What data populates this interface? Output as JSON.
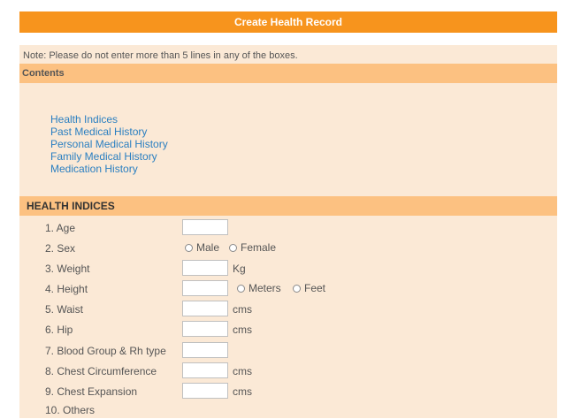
{
  "header": {
    "title": "Create Health Record"
  },
  "note": "Note: Please do not enter more than 5 lines in any of the boxes.",
  "contents": {
    "title": "Contents",
    "items": [
      "Health Indices",
      "Past Medical History",
      "Personal Medical History",
      "Family Medical History",
      "Medication History"
    ]
  },
  "health_indices": {
    "title": "HEALTH INDICES",
    "rows": {
      "age": {
        "label": "1. Age"
      },
      "sex": {
        "label": "2. Sex",
        "options": [
          "Male",
          "Female"
        ]
      },
      "weight": {
        "label": "3. Weight",
        "unit": "Kg"
      },
      "height": {
        "label": "4. Height",
        "options": [
          "Meters",
          "Feet"
        ]
      },
      "waist": {
        "label": "5. Waist",
        "unit": "cms"
      },
      "hip": {
        "label": "6. Hip",
        "unit": "cms"
      },
      "blood": {
        "label": "7. Blood Group & Rh type"
      },
      "chest_circ": {
        "label": "8. Chest Circumference",
        "unit": "cms"
      },
      "chest_exp": {
        "label": "9. Chest Expansion",
        "unit": "cms"
      },
      "others": {
        "label": "10. Others"
      }
    }
  }
}
